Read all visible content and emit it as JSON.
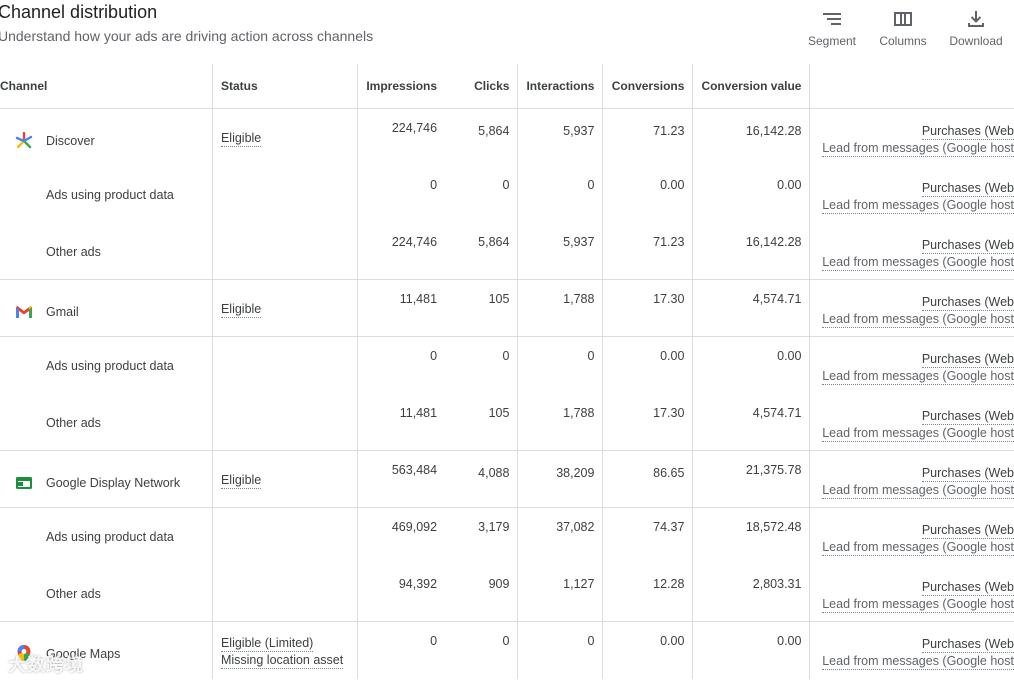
{
  "header": {
    "title": "Channel distribution",
    "subtitle": "Understand how your ads are driving action across channels"
  },
  "toolbar": {
    "segment": "Segment",
    "columns": "Columns",
    "download": "Download"
  },
  "columns": {
    "channel": "Channel",
    "status": "Status",
    "impressions": "Impressions",
    "clicks": "Clicks",
    "interactions": "Interactions",
    "conversions": "Conversions",
    "conversion_value": "Conversion value"
  },
  "conv_text": {
    "line1": "Purchases (Web",
    "line2": "Lead from messages (Google host"
  },
  "rows": [
    {
      "channel": "Discover",
      "status": "Eligible",
      "status2": "",
      "impressions": "224,746",
      "clicks": "5,864",
      "interactions": "5,937",
      "conversions": "71.23",
      "value": "16,142.28"
    },
    {
      "channel": "Ads using product data",
      "status": "",
      "status2": "",
      "impressions": "0",
      "clicks": "0",
      "interactions": "0",
      "conversions": "0.00",
      "value": "0.00"
    },
    {
      "channel": "Other ads",
      "status": "",
      "status2": "",
      "impressions": "224,746",
      "clicks": "5,864",
      "interactions": "5,937",
      "conversions": "71.23",
      "value": "16,142.28"
    },
    {
      "channel": "Gmail",
      "status": "Eligible",
      "status2": "",
      "impressions": "11,481",
      "clicks": "105",
      "interactions": "1,788",
      "conversions": "17.30",
      "value": "4,574.71"
    },
    {
      "channel": "Ads using product data",
      "status": "",
      "status2": "",
      "impressions": "0",
      "clicks": "0",
      "interactions": "0",
      "conversions": "0.00",
      "value": "0.00"
    },
    {
      "channel": "Other ads",
      "status": "",
      "status2": "",
      "impressions": "11,481",
      "clicks": "105",
      "interactions": "1,788",
      "conversions": "17.30",
      "value": "4,574.71"
    },
    {
      "channel": "Google Display Network",
      "status": "Eligible",
      "status2": "",
      "impressions": "563,484",
      "clicks": "4,088",
      "interactions": "38,209",
      "conversions": "86.65",
      "value": "21,375.78"
    },
    {
      "channel": "Ads using product data",
      "status": "",
      "status2": "",
      "impressions": "469,092",
      "clicks": "3,179",
      "interactions": "37,082",
      "conversions": "74.37",
      "value": "18,572.48"
    },
    {
      "channel": "Other ads",
      "status": "",
      "status2": "",
      "impressions": "94,392",
      "clicks": "909",
      "interactions": "1,127",
      "conversions": "12.28",
      "value": "2,803.31"
    },
    {
      "channel": "Google Maps",
      "status": "Eligible (Limited)",
      "status2": "Missing location asset",
      "impressions": "0",
      "clicks": "0",
      "interactions": "0",
      "conversions": "0.00",
      "value": "0.00"
    }
  ],
  "watermark": "大数跨境",
  "icons": {
    "discover": "discover-asterisk-icon",
    "gmail": "gmail-m-icon",
    "display": "display-network-icon",
    "maps": "maps-pin-icon"
  }
}
